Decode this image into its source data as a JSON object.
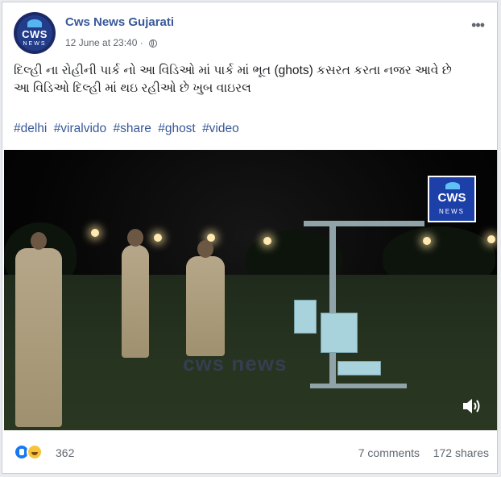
{
  "post": {
    "page_name": "Cws News Gujarati",
    "timestamp": "12 June at 23:40",
    "separator": "·",
    "avatar_logo_text": "CWS",
    "avatar_logo_sub": "NEWS",
    "privacy_icon": "globe-icon",
    "more_icon": "ellipsis-icon",
    "more_label": "•••",
    "text_lines": [
      "દિલ્હી ના રોહીની પાર્ક નો આ વિડિઓ માં પાર્ક માં ભૂત (ghots) કસરત કરતા નજર આવે છે",
      "આ વિડિઓ દિલ્હી માં થઇ રહીઓ છે ખુબ વાઇરલ"
    ],
    "hashtags": [
      "#delhi",
      "#viralvido",
      "#share",
      "#ghost",
      "#video"
    ]
  },
  "video": {
    "badge_text": "CWS",
    "badge_sub": "NEWS",
    "watermark": "cws news",
    "volume_icon": "volume-icon"
  },
  "footer": {
    "reaction_icons": [
      "like-icon",
      "haha-icon"
    ],
    "reaction_count": "362",
    "comments": "7 comments",
    "shares": "172 shares"
  },
  "colors": {
    "link": "#385898",
    "secondary_text": "#606770",
    "like": "#1877f2",
    "haha": "#f7c33a"
  }
}
